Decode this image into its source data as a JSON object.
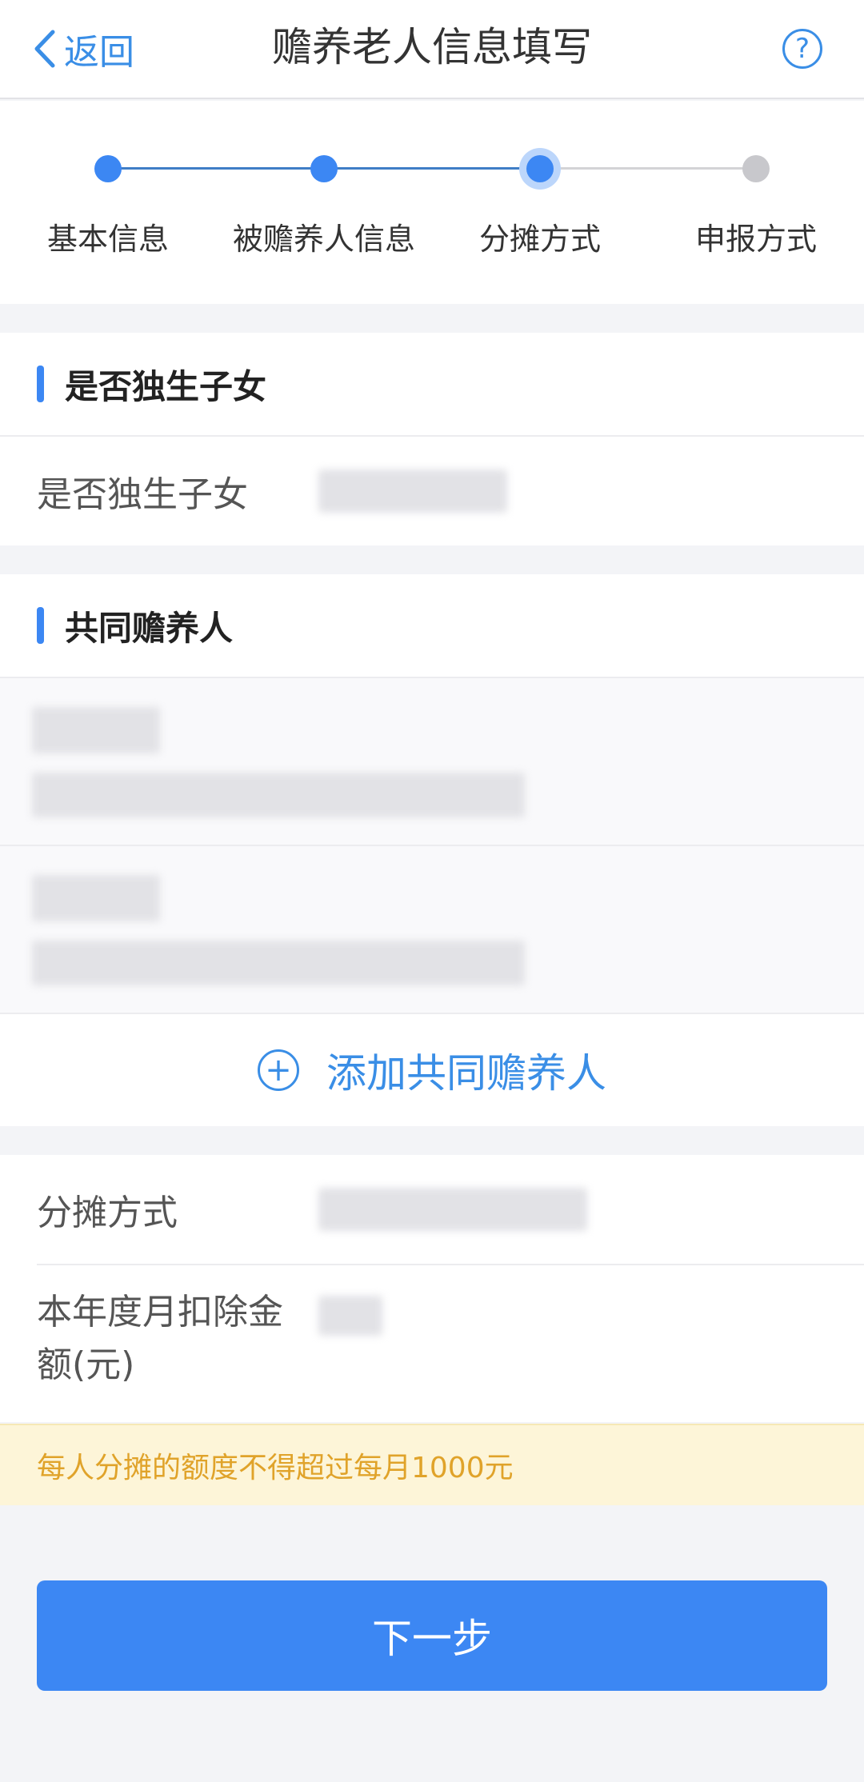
{
  "header": {
    "back_label": "返回",
    "title": "赡养老人信息填写",
    "help_symbol": "?"
  },
  "steps": [
    {
      "label": "基本信息",
      "state": "done"
    },
    {
      "label": "被赡养人信息",
      "state": "done"
    },
    {
      "label": "分摊方式",
      "state": "current"
    },
    {
      "label": "申报方式",
      "state": "todo"
    }
  ],
  "only_child_section": {
    "title": "是否独生子女",
    "field_label": "是否独生子女",
    "field_value": ""
  },
  "co_supporters_section": {
    "title": "共同赡养人",
    "people": [
      {
        "name": "",
        "detail": ""
      },
      {
        "name": "",
        "detail": ""
      }
    ],
    "add_icon_symbol": "+",
    "add_label": "添加共同赡养人"
  },
  "split_section": {
    "method_label": "分摊方式",
    "method_value": "",
    "amount_label": "本年度月扣除金额(元)",
    "amount_value": ""
  },
  "notice": "每人分摊的额度不得超过每月1000元",
  "next_button": "下一步",
  "colors": {
    "accent": "#3c87f3",
    "link": "#3a8ee6",
    "notice_bg": "#fdf5d8",
    "notice_text": "#e0a32a"
  }
}
